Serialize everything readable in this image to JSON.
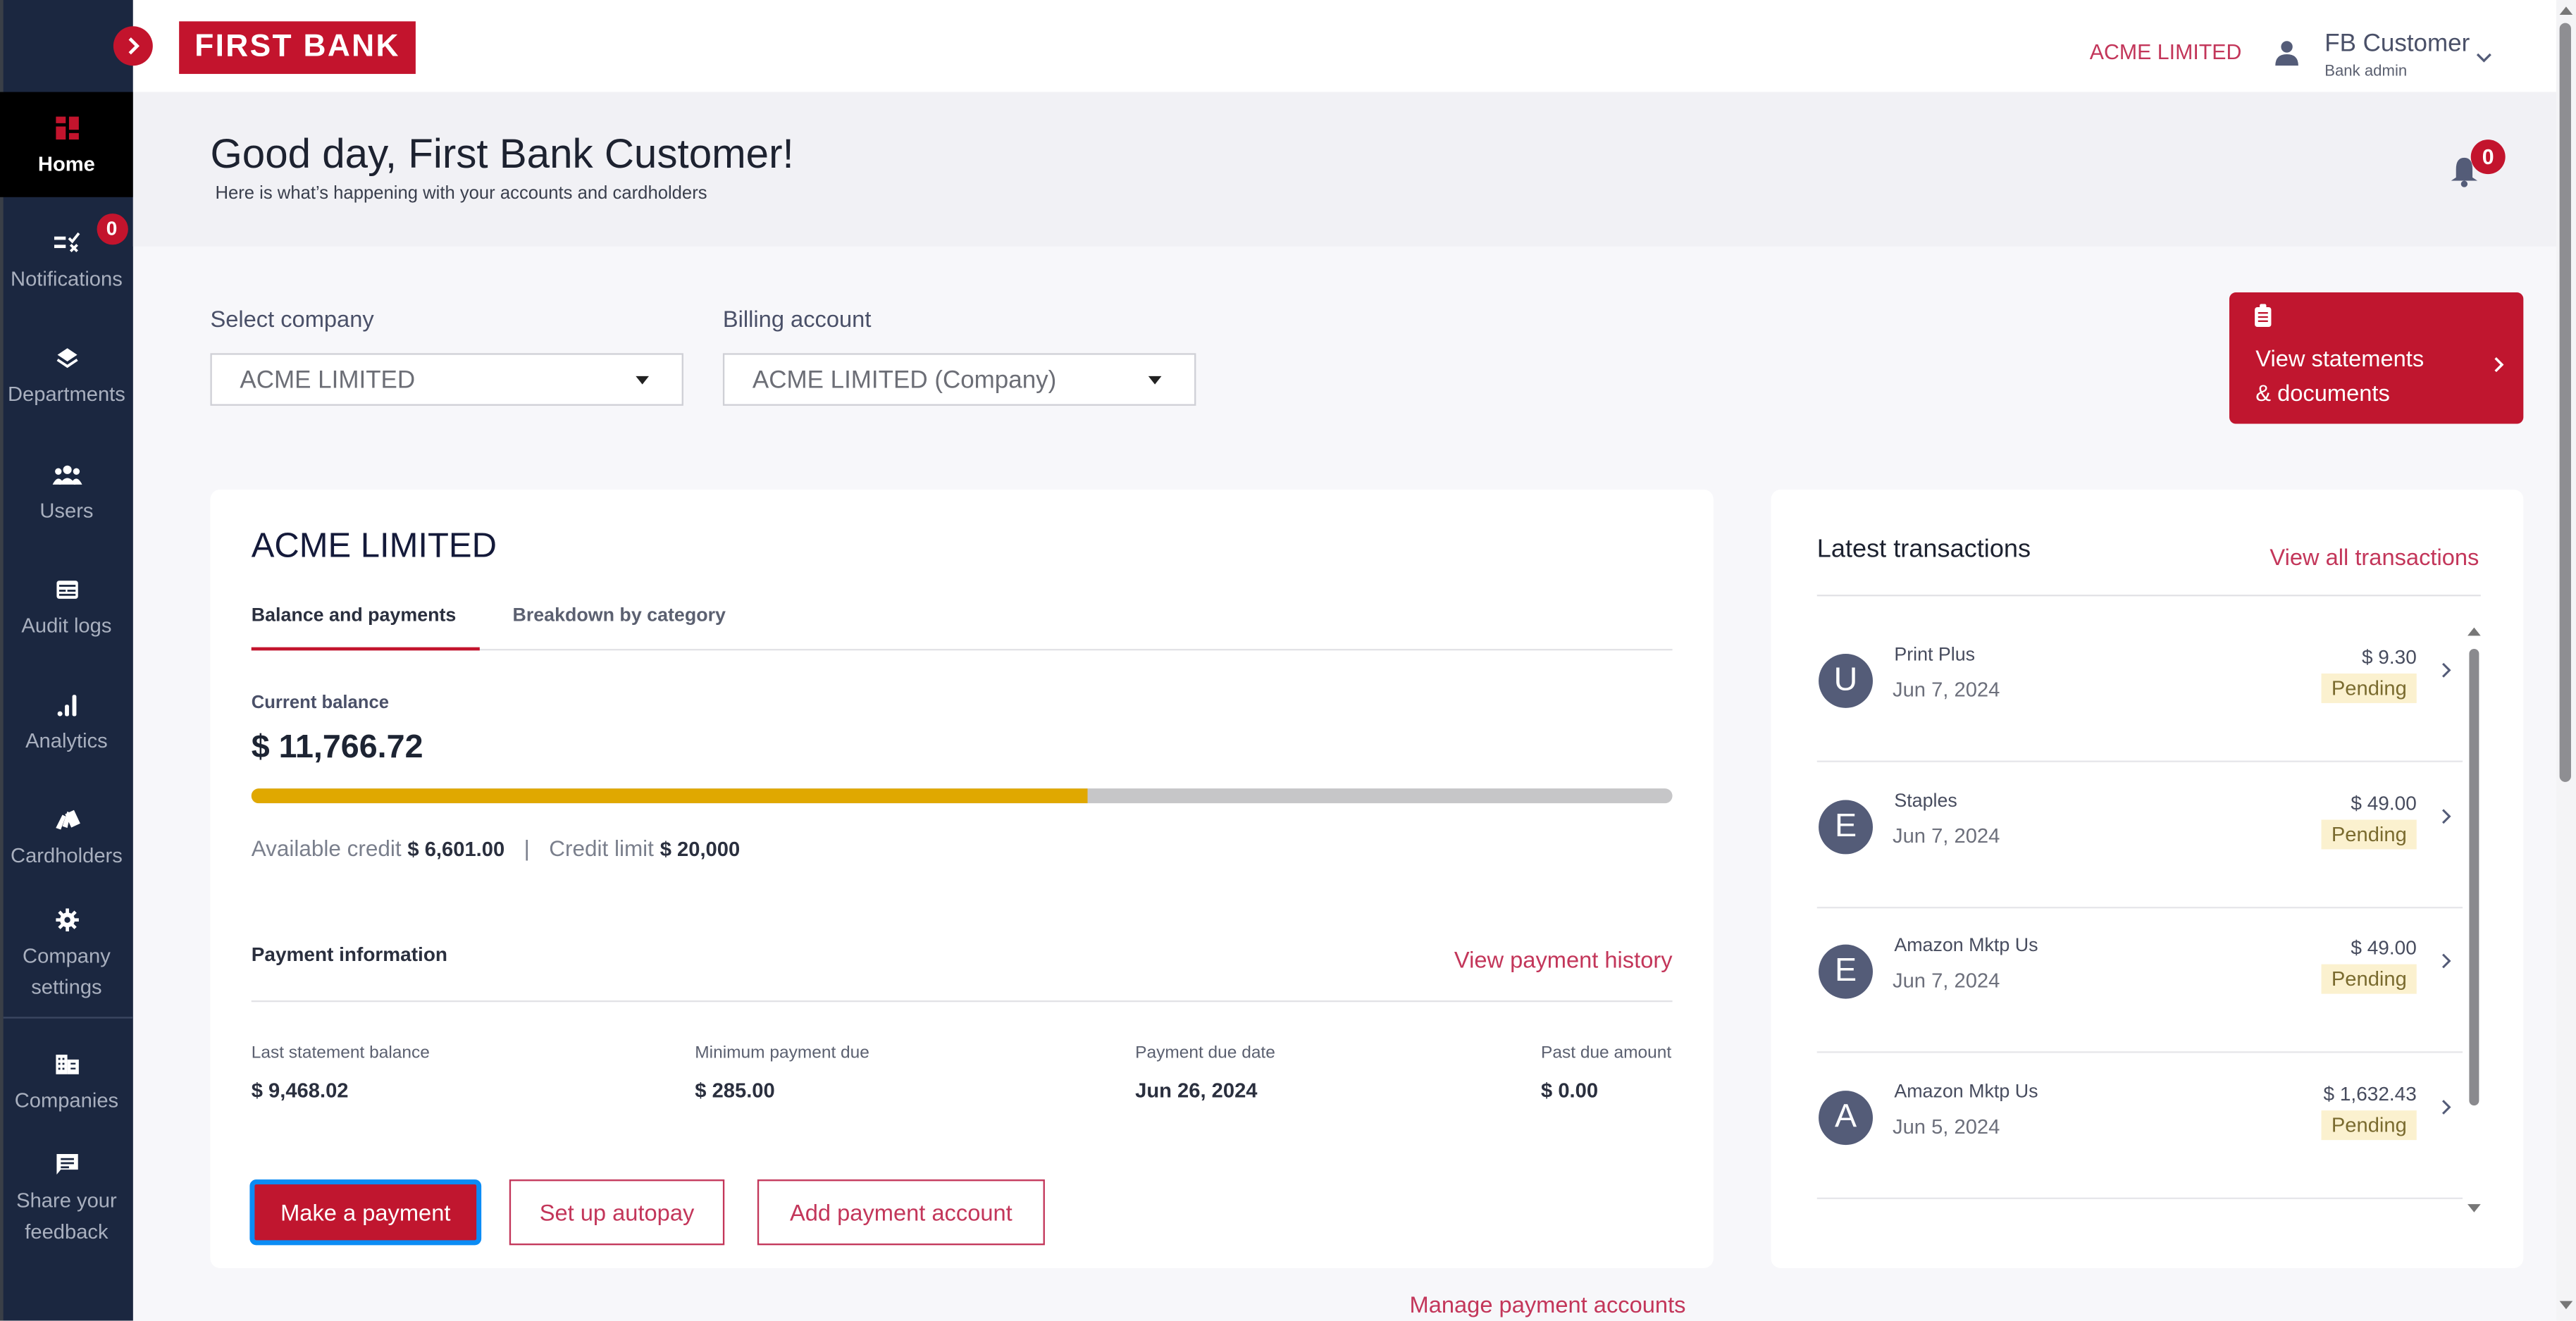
{
  "brand": {
    "logo_text": "FIRST BANK",
    "accent_color": "#c3142d"
  },
  "sidebar": {
    "items": [
      {
        "label": "Home",
        "icon": "home-grid-icon",
        "active": true
      },
      {
        "label": "Notifications",
        "icon": "notifications-checklist-icon",
        "badge": "0"
      },
      {
        "label": "Departments",
        "icon": "layers-icon"
      },
      {
        "label": "Users",
        "icon": "users-group-icon"
      },
      {
        "label": "Audit logs",
        "icon": "audit-log-icon"
      },
      {
        "label": "Analytics",
        "icon": "bar-chart-icon"
      },
      {
        "label": "Cardholders",
        "icon": "cards-icon"
      },
      {
        "label": "Company settings",
        "label_line1": "Company",
        "label_line2": "settings",
        "icon": "gear-icon"
      },
      {
        "label": "Companies",
        "icon": "building-icon"
      },
      {
        "label": "Share your feedback",
        "label_line1": "Share your",
        "label_line2": "feedback",
        "icon": "feedback-chat-icon"
      }
    ]
  },
  "header": {
    "company": "ACME LIMITED",
    "user_name": "FB Customer",
    "user_role": "Bank admin"
  },
  "greeting": {
    "title": "Good day, First Bank Customer!",
    "subtitle": "Here is what’s happening with your accounts and cardholders",
    "notification_count": "0"
  },
  "filters": {
    "company_label": "Select company",
    "company_value": "ACME LIMITED",
    "billing_label": "Billing account",
    "billing_value": "ACME LIMITED (Company)"
  },
  "statements_button": {
    "line1": "View statements",
    "line2": "& documents"
  },
  "account": {
    "title": "ACME LIMITED",
    "tabs": [
      {
        "label": "Balance and payments",
        "active": true
      },
      {
        "label": "Breakdown by category",
        "active": false
      }
    ],
    "current_balance_label": "Current balance",
    "current_balance": "$ 11,766.72",
    "utilization_fraction": 0.588,
    "available_credit_label": "Available credit",
    "available_credit": "$ 6,601.00",
    "credit_limit_label": "Credit limit",
    "credit_limit": "$ 20,000",
    "separator": "|"
  },
  "payment_info": {
    "title": "Payment information",
    "history_link": "View payment history",
    "fields": [
      {
        "label": "Last statement balance",
        "value": "$ 9,468.02"
      },
      {
        "label": "Minimum payment due",
        "value": "$ 285.00"
      },
      {
        "label": "Payment due date",
        "value": "Jun 26, 2024"
      },
      {
        "label": "Past due amount",
        "value": "$ 0.00"
      }
    ],
    "buttons": {
      "make_payment": "Make a payment",
      "autopay": "Set up autopay",
      "add_account": "Add payment account"
    },
    "manage_link": "Manage payment accounts"
  },
  "transactions": {
    "title": "Latest transactions",
    "view_all": "View all transactions",
    "items": [
      {
        "initial": "U",
        "merchant": "Print Plus",
        "date": "Jun 7, 2024",
        "amount": "$ 9.30",
        "status": "Pending"
      },
      {
        "initial": "E",
        "merchant": "Staples",
        "date": "Jun 7, 2024",
        "amount": "$ 49.00",
        "status": "Pending"
      },
      {
        "initial": "E",
        "merchant": "Amazon Mktp Us",
        "date": "Jun 7, 2024",
        "amount": "$ 49.00",
        "status": "Pending"
      },
      {
        "initial": "A",
        "merchant": "Amazon Mktp Us",
        "date": "Jun 5, 2024",
        "amount": "$ 1,632.43",
        "status": "Pending"
      }
    ]
  }
}
